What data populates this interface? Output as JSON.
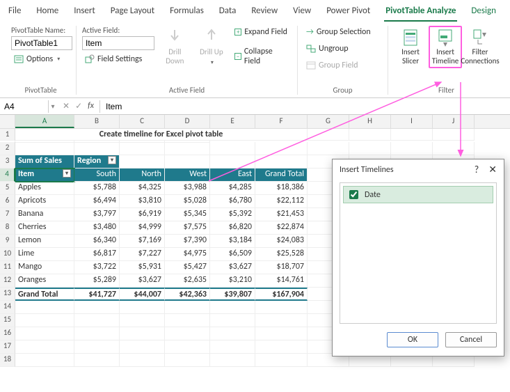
{
  "tabs": [
    "File",
    "Home",
    "Insert",
    "Page Layout",
    "Formulas",
    "Data",
    "Review",
    "View",
    "Power Pivot",
    "PivotTable Analyze",
    "Design"
  ],
  "active_tab_index": 9,
  "ribbon": {
    "pivottable": {
      "name_label": "PivotTable Name:",
      "name_value": "PivotTable1",
      "options_label": "Options",
      "group_label": "PivotTable"
    },
    "activefield": {
      "field_label": "Active Field:",
      "field_value": "Item",
      "settings_label": "Field Settings",
      "drill_down": "Drill Down",
      "drill_up": "Drill Up",
      "expand_label": "Expand Field",
      "collapse_label": "Collapse Field",
      "group_label": "Active Field"
    },
    "group": {
      "selection": "Group Selection",
      "ungroup": "Ungroup",
      "field": "Group Field",
      "group_label": "Group"
    },
    "filter": {
      "slicer": "Insert Slicer",
      "timeline": "Insert Timeline",
      "connections": "Filter Connections",
      "group_label": "Filter"
    }
  },
  "namebox": "A4",
  "formula": "Item",
  "columns": [
    "A",
    "B",
    "C",
    "D",
    "E",
    "F",
    "G",
    "H",
    "I",
    "J"
  ],
  "title": "Create timeline for Excel pivot table",
  "pivot": {
    "measure": "Sum of Sales",
    "col_field": "Region",
    "row_field": "Item",
    "cols": [
      "South",
      "North",
      "West",
      "East",
      "Grand Total"
    ],
    "rows": [
      {
        "label": "Apples",
        "v": [
          "$5,788",
          "$4,325",
          "$3,988",
          "$4,285",
          "$18,386"
        ]
      },
      {
        "label": "Apricots",
        "v": [
          "$6,494",
          "$3,810",
          "$5,028",
          "$6,780",
          "$22,112"
        ]
      },
      {
        "label": "Banana",
        "v": [
          "$3,797",
          "$6,919",
          "$5,345",
          "$5,392",
          "$21,453"
        ]
      },
      {
        "label": "Cherries",
        "v": [
          "$3,480",
          "$4,999",
          "$7,575",
          "$6,820",
          "$22,874"
        ]
      },
      {
        "label": "Lemon",
        "v": [
          "$6,340",
          "$7,169",
          "$7,390",
          "$3,184",
          "$24,083"
        ]
      },
      {
        "label": "Lime",
        "v": [
          "$6,817",
          "$7,227",
          "$4,975",
          "$6,509",
          "$25,528"
        ]
      },
      {
        "label": "Mango",
        "v": [
          "$3,722",
          "$5,931",
          "$5,427",
          "$3,627",
          "$18,707"
        ]
      },
      {
        "label": "Oranges",
        "v": [
          "$5,289",
          "$3,627",
          "$2,635",
          "$3,210",
          "$14,761"
        ]
      }
    ],
    "grand_total_label": "Grand Total",
    "grand_total": [
      "$41,727",
      "$44,007",
      "$42,363",
      "$39,807",
      "$167,904"
    ]
  },
  "dialog": {
    "title": "Insert Timelines",
    "field": "Date",
    "ok": "OK",
    "cancel": "Cancel"
  },
  "chart_data": {
    "type": "table",
    "title": "Create timeline for Excel pivot table",
    "measure": "Sum of Sales",
    "row_field": "Item",
    "col_field": "Region",
    "columns": [
      "South",
      "North",
      "West",
      "East",
      "Grand Total"
    ],
    "rows": [
      {
        "Item": "Apples",
        "South": 5788,
        "North": 4325,
        "West": 3988,
        "East": 4285,
        "Grand Total": 18386
      },
      {
        "Item": "Apricots",
        "South": 6494,
        "North": 3810,
        "West": 5028,
        "East": 6780,
        "Grand Total": 22112
      },
      {
        "Item": "Banana",
        "South": 3797,
        "North": 6919,
        "West": 5345,
        "East": 5392,
        "Grand Total": 21453
      },
      {
        "Item": "Cherries",
        "South": 3480,
        "North": 4999,
        "West": 7575,
        "East": 6820,
        "Grand Total": 22874
      },
      {
        "Item": "Lemon",
        "South": 6340,
        "North": 7169,
        "West": 7390,
        "East": 3184,
        "Grand Total": 24083
      },
      {
        "Item": "Lime",
        "South": 6817,
        "North": 7227,
        "West": 4975,
        "East": 6509,
        "Grand Total": 25528
      },
      {
        "Item": "Mango",
        "South": 3722,
        "North": 5931,
        "West": 5427,
        "East": 3627,
        "Grand Total": 18707
      },
      {
        "Item": "Oranges",
        "South": 5289,
        "North": 3627,
        "West": 2635,
        "East": 3210,
        "Grand Total": 14761
      }
    ],
    "grand_total": {
      "South": 41727,
      "North": 44007,
      "West": 42363,
      "East": 39807,
      "Grand Total": 167904
    }
  }
}
